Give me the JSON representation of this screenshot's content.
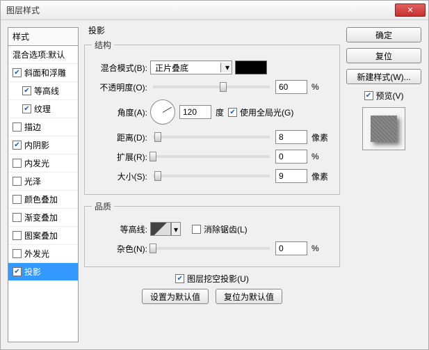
{
  "window": {
    "title": "图层样式"
  },
  "sidebar": {
    "header": "样式",
    "items": [
      {
        "label": "混合选项:默认",
        "checked": null,
        "indent": false
      },
      {
        "label": "斜面和浮雕",
        "checked": true,
        "indent": false
      },
      {
        "label": "等高线",
        "checked": true,
        "indent": true
      },
      {
        "label": "纹理",
        "checked": true,
        "indent": true
      },
      {
        "label": "描边",
        "checked": false,
        "indent": false
      },
      {
        "label": "内阴影",
        "checked": true,
        "indent": false
      },
      {
        "label": "内发光",
        "checked": false,
        "indent": false
      },
      {
        "label": "光泽",
        "checked": false,
        "indent": false
      },
      {
        "label": "颜色叠加",
        "checked": false,
        "indent": false
      },
      {
        "label": "渐变叠加",
        "checked": false,
        "indent": false
      },
      {
        "label": "图案叠加",
        "checked": false,
        "indent": false
      },
      {
        "label": "外发光",
        "checked": false,
        "indent": false
      },
      {
        "label": "投影",
        "checked": true,
        "indent": false,
        "selected": true
      }
    ]
  },
  "panel": {
    "title": "投影",
    "structure": {
      "legend": "结构",
      "blend_mode_label": "混合模式(B):",
      "blend_mode_value": "正片叠底",
      "opacity_label": "不透明度(O):",
      "opacity_value": "60",
      "opacity_unit": "%",
      "angle_label": "角度(A):",
      "angle_value": "120",
      "angle_unit": "度",
      "global_light_label": "使用全局光(G)",
      "global_light_checked": true,
      "distance_label": "距离(D):",
      "distance_value": "8",
      "distance_unit": "像素",
      "spread_label": "扩展(R):",
      "spread_value": "0",
      "spread_unit": "%",
      "size_label": "大小(S):",
      "size_value": "9",
      "size_unit": "像素"
    },
    "quality": {
      "legend": "品质",
      "contour_label": "等高线:",
      "antialias_label": "消除锯齿(L)",
      "antialias_checked": false,
      "noise_label": "杂色(N):",
      "noise_value": "0",
      "noise_unit": "%"
    },
    "knockout_label": "图层挖空投影(U)",
    "knockout_checked": true,
    "set_default": "设置为默认值",
    "reset_default": "复位为默认值"
  },
  "right": {
    "ok": "确定",
    "cancel": "复位",
    "new_style": "新建样式(W)...",
    "preview_label": "预览(V)",
    "preview_checked": true
  }
}
